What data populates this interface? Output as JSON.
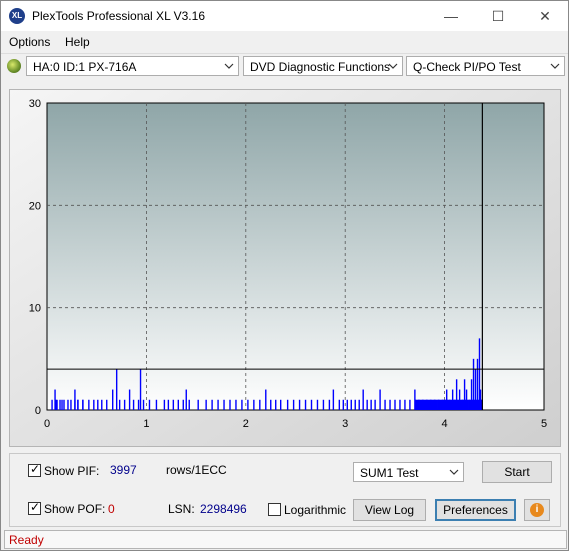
{
  "window": {
    "title": "PlexTools Professional XL V3.16",
    "app_icon_text": "XL",
    "minimize": "—",
    "maximize": "☐",
    "close": "✕"
  },
  "menu": {
    "items": [
      "Options",
      "Help"
    ]
  },
  "toolbar": {
    "drive": "HA:0 ID:1  PX-716A",
    "function": "DVD Diagnostic Functions",
    "test": "Q-Check PI/PO Test"
  },
  "chart_data": {
    "type": "bar",
    "title": "",
    "xlabel": "",
    "ylabel": "",
    "xlim": [
      0,
      5
    ],
    "ylim": [
      0,
      30
    ],
    "x_ticks": [
      "0",
      "1",
      "2",
      "3",
      "4",
      "5"
    ],
    "y_ticks": [
      "0",
      "10",
      "20",
      "30"
    ],
    "grid": true,
    "threshold_line": 4,
    "end_marker_x": 4.38,
    "series": [
      {
        "color": "#0000ff",
        "points": [
          [
            0.05,
            1
          ],
          [
            0.09,
            1
          ],
          [
            0.13,
            1
          ],
          [
            0.17,
            1
          ],
          [
            0.21,
            1
          ],
          [
            0.24,
            1
          ],
          [
            0.28,
            1
          ],
          [
            0.31,
            1
          ],
          [
            0.36,
            1
          ],
          [
            0.42,
            1
          ],
          [
            0.47,
            1
          ],
          [
            0.51,
            1
          ],
          [
            0.55,
            1
          ],
          [
            0.08,
            2
          ],
          [
            0.1,
            1
          ],
          [
            0.15,
            1
          ],
          [
            0.28,
            2
          ],
          [
            0.31,
            1
          ],
          [
            0.36,
            1
          ],
          [
            0.6,
            1
          ],
          [
            0.66,
            2
          ],
          [
            0.7,
            4
          ],
          [
            0.73,
            1
          ],
          [
            0.78,
            1
          ],
          [
            0.83,
            2
          ],
          [
            0.87,
            1
          ],
          [
            0.92,
            1
          ],
          [
            0.94,
            4
          ],
          [
            0.97,
            1
          ],
          [
            1.03,
            1
          ],
          [
            1.1,
            1
          ],
          [
            1.18,
            1
          ],
          [
            1.22,
            1
          ],
          [
            1.27,
            1
          ],
          [
            1.32,
            1
          ],
          [
            1.37,
            1
          ],
          [
            1.4,
            2
          ],
          [
            1.43,
            1
          ],
          [
            1.52,
            1
          ],
          [
            1.6,
            1
          ],
          [
            1.66,
            1
          ],
          [
            1.72,
            1
          ],
          [
            1.78,
            1
          ],
          [
            1.84,
            1
          ],
          [
            1.9,
            1
          ],
          [
            1.96,
            1
          ],
          [
            2.02,
            1
          ],
          [
            2.08,
            1
          ],
          [
            2.14,
            1
          ],
          [
            2.2,
            2
          ],
          [
            2.25,
            1
          ],
          [
            2.3,
            1
          ],
          [
            2.35,
            1
          ],
          [
            2.42,
            1
          ],
          [
            2.48,
            1
          ],
          [
            2.54,
            1
          ],
          [
            2.6,
            1
          ],
          [
            2.66,
            1
          ],
          [
            2.72,
            1
          ],
          [
            2.78,
            1
          ],
          [
            2.84,
            1
          ],
          [
            2.88,
            2
          ],
          [
            2.94,
            1
          ],
          [
            2.98,
            1
          ],
          [
            3.02,
            1
          ],
          [
            3.06,
            1
          ],
          [
            3.1,
            1
          ],
          [
            3.14,
            1
          ],
          [
            3.18,
            2
          ],
          [
            3.22,
            1
          ],
          [
            3.26,
            1
          ],
          [
            3.3,
            1
          ],
          [
            3.35,
            2
          ],
          [
            3.4,
            1
          ],
          [
            3.45,
            1
          ],
          [
            3.5,
            1
          ],
          [
            3.55,
            1
          ],
          [
            3.6,
            1
          ],
          [
            3.65,
            1
          ],
          [
            3.7,
            2
          ],
          [
            3.74,
            1
          ],
          [
            3.78,
            1
          ],
          [
            3.82,
            1
          ],
          [
            3.86,
            1
          ],
          [
            3.9,
            1
          ],
          [
            3.94,
            1
          ],
          [
            3.98,
            1
          ],
          [
            4.0,
            1
          ],
          [
            4.02,
            2
          ],
          [
            4.05,
            1
          ],
          [
            4.08,
            2
          ],
          [
            4.1,
            1
          ],
          [
            4.12,
            3
          ],
          [
            4.15,
            2
          ],
          [
            4.18,
            1
          ],
          [
            4.2,
            3
          ],
          [
            4.22,
            2
          ],
          [
            4.25,
            1
          ],
          [
            4.27,
            3
          ],
          [
            4.29,
            5
          ],
          [
            4.31,
            4
          ],
          [
            4.33,
            5
          ],
          [
            4.35,
            7
          ],
          [
            4.36,
            2
          ],
          [
            4.37,
            1
          ]
        ]
      }
    ]
  },
  "controls": {
    "show_pif_label": "Show PIF:",
    "pif_value": "3997",
    "pif_unit": "rows/1ECC",
    "show_pof_label": "Show POF:",
    "pof_value": "0",
    "lsn_label": "LSN:",
    "lsn_value": "2298496",
    "logarithmic_label": "Logarithmic",
    "test_select": "SUM1 Test",
    "start_button": "Start",
    "view_log_button": "View Log",
    "preferences_button": "Preferences",
    "info_icon": "i",
    "checkmark": "✓"
  },
  "status": {
    "text": "Ready"
  }
}
